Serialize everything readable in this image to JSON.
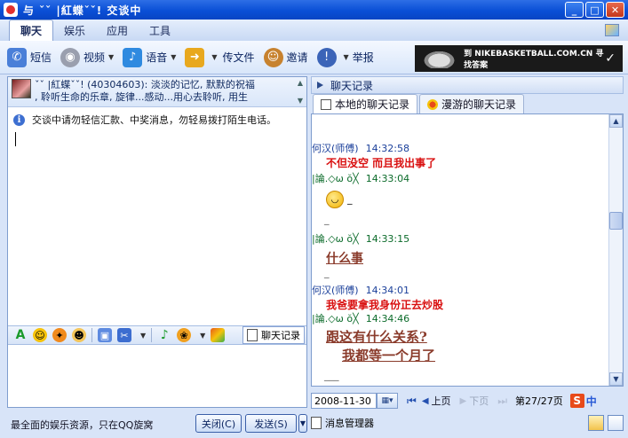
{
  "window": {
    "title": "与 ˇˇ |紅蝶ˇˇ! 交谈中",
    "controls": [
      "minimize",
      "maximize",
      "close"
    ]
  },
  "menu": {
    "tabs": [
      "聊天",
      "娱乐",
      "应用",
      "工具"
    ],
    "active": "聊天"
  },
  "toolbar": {
    "items": [
      {
        "label": "短信",
        "icon": "phone-icon"
      },
      {
        "label": "视频",
        "icon": "webcam-icon"
      },
      {
        "label": "语音",
        "icon": "microphone-icon"
      },
      {
        "label": "传文件",
        "icon": "file-transfer-icon"
      },
      {
        "label": "邀请",
        "icon": "invite-user-icon"
      },
      {
        "label": "举报",
        "icon": "report-icon"
      }
    ],
    "banner_text": "到 NIKEBASKETBALL.COM.CN 寻找答案"
  },
  "contact": {
    "signature_line1": "ˇˇ |紅蝶ˇˇ! (40304603): 淡淡的记忆, 默默的祝福",
    "signature_line2": ", 聆听生命的乐章, 旋律...感动...用心去聆听, 用生"
  },
  "notice": {
    "text": "交谈中请勿轻信汇款、中奖消息，勿轻易拨打陌生电话。"
  },
  "format_bar": {
    "history_label": "聊天记录"
  },
  "footer": {
    "ad_text": "最全面的娱乐资源，只在QQ旋窝",
    "close_label": "关闭(C)",
    "send_label": "发送(S)"
  },
  "history": {
    "header": "聊天记录",
    "tabs": [
      "本地的聊天记录",
      "漫游的聊天记录"
    ],
    "messages": [
      {
        "sender": "何汉(师傅)",
        "time": "14:32:58",
        "text": "不但没空  而且我出事了",
        "style": "red"
      },
      {
        "sender": "|論.◇ω ŏ╳",
        "time": "14:33:04",
        "text": "",
        "style": "smile"
      },
      {
        "sender": "|論.◇ω ŏ╳",
        "time": "14:33:15",
        "text": "什么事",
        "style": "brown"
      },
      {
        "sender": "何汉(师傅)",
        "time": "14:34:01",
        "text": "我爸要拿我身份正去炒股",
        "style": "red"
      },
      {
        "sender": "|論.◇ω ŏ╳",
        "time": "14:34:46",
        "text": "跟这有什么关系?",
        "text2": "我都等一个月了",
        "style": "brown"
      }
    ],
    "date": "2008-11-30",
    "prev_label": "上页",
    "next_label": "下页",
    "page": "第27/27页",
    "manager_label": "消息管理器"
  }
}
